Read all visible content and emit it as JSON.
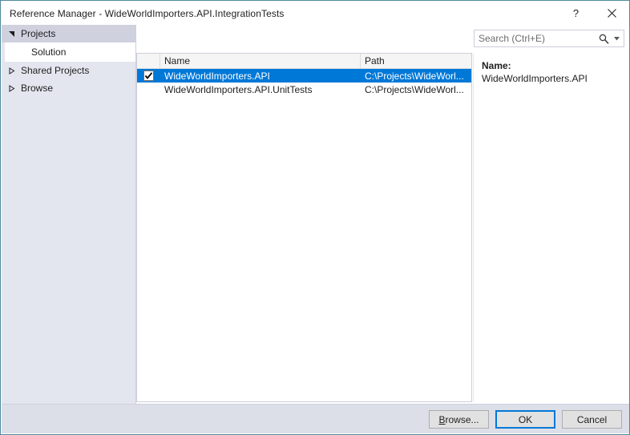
{
  "window": {
    "title": "Reference Manager - WideWorldImporters.API.IntegrationTests",
    "help_button": "?",
    "close_button": "✕",
    "help_icon_name": "help-icon",
    "close_icon_name": "close-icon"
  },
  "sidebar": {
    "items": [
      {
        "label": "Projects",
        "level": "group",
        "expanded": true,
        "selected": true,
        "arrow": "expanded"
      },
      {
        "label": "Solution",
        "level": "child",
        "expanded": false,
        "selected": false,
        "arrow": "none"
      },
      {
        "label": "Shared Projects",
        "level": "group",
        "expanded": false,
        "selected": false,
        "arrow": "collapsed"
      },
      {
        "label": "Browse",
        "level": "group",
        "expanded": false,
        "selected": false,
        "arrow": "collapsed"
      }
    ]
  },
  "search": {
    "placeholder": "Search (Ctrl+E)",
    "value": "",
    "icon": "search-icon",
    "dropdown_icon": "chevron-down-icon"
  },
  "list": {
    "columns": [
      "",
      "Name",
      "Path"
    ],
    "rows": [
      {
        "checked": true,
        "selected": true,
        "name": "WideWorldImporters.API",
        "path": "C:\\Projects\\WideWorl..."
      },
      {
        "checked": false,
        "selected": false,
        "name": "WideWorldImporters.API.UnitTests",
        "path": "C:\\Projects\\WideWorl..."
      }
    ]
  },
  "details": {
    "name_label": "Name:",
    "name_value": "WideWorldImporters.API"
  },
  "footer": {
    "browse_label": "Browse...",
    "browse_mnemonic": "B",
    "browse_rest": "rowse...",
    "ok_label": "OK",
    "cancel_label": "Cancel"
  },
  "colors": {
    "accent": "#0078d7",
    "dialog_border": "#4f8a9b",
    "sidebar_bg": "#e4e6ef",
    "sidebar_selected": "#cfd1df",
    "footer_bg": "#dcdfe8",
    "header_bg": "#f5f5f5"
  }
}
